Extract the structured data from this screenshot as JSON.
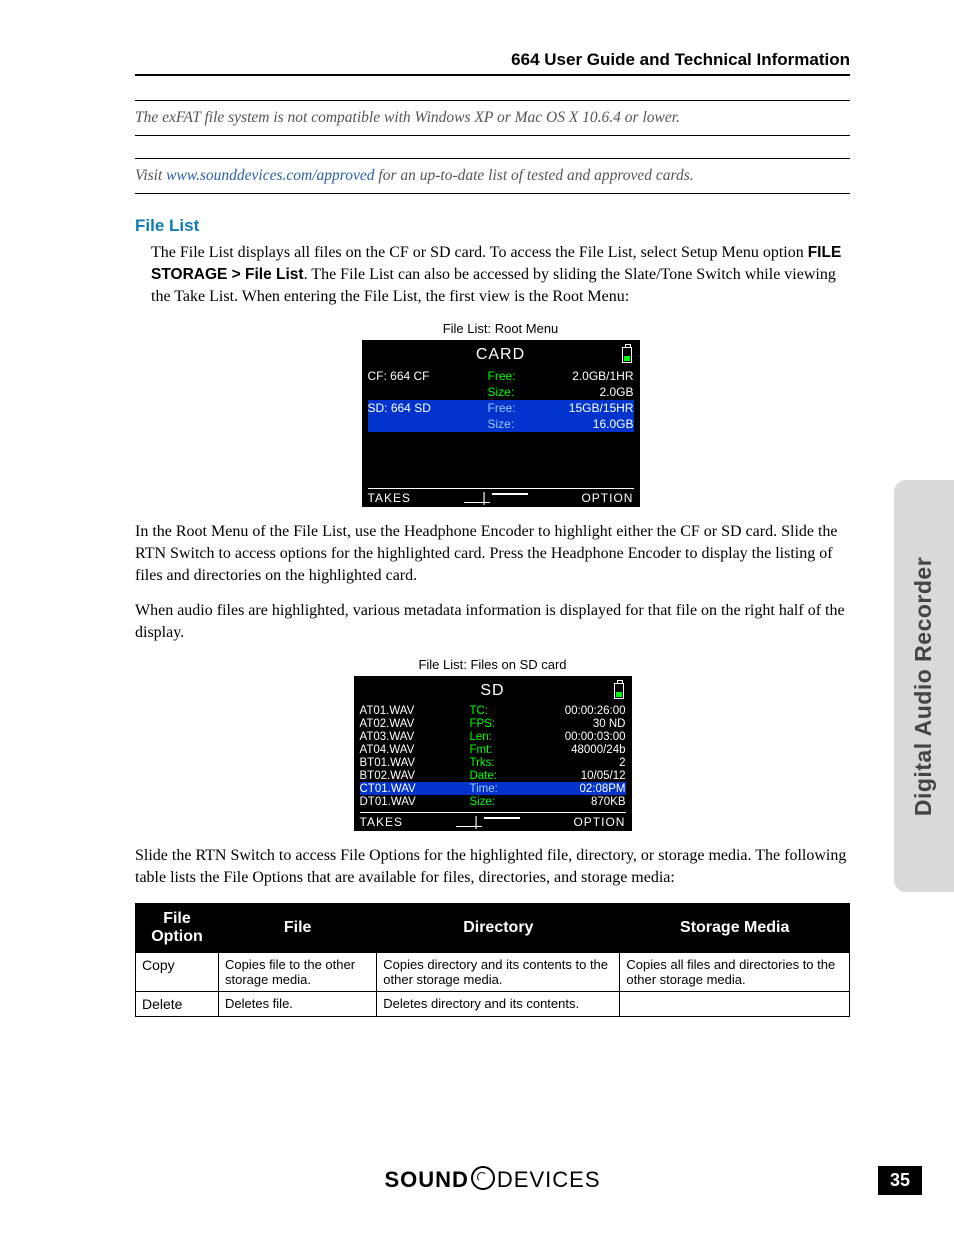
{
  "header": {
    "title": "664 User Guide and Technical Information"
  },
  "callouts": {
    "exfat": "The exFAT file system is not compatible with Windows XP or Mac OS X 10.6.4 or lower.",
    "visit_pre": "Visit ",
    "visit_link": "www.sounddevices.com/approved",
    "visit_post": " for an up-to-date list of tested and approved cards."
  },
  "section": {
    "title": "File List"
  },
  "paragraphs": {
    "p1a": "The File List displays all files on the CF or SD card. To access the File List, select Setup Menu option ",
    "p1_menu": "FILE STORAGE > File List",
    "p1b": ". The File List can also be accessed by sliding the Slate/Tone Switch while viewing the Take List. When entering the File List, the first view is the Root Menu:",
    "p2": "In the Root Menu of the File List, use the Headphone Encoder to highlight either the CF or SD card. Slide the RTN Switch to access options for the highlighted card. Press the Headphone Encoder to display the listing of files and directories  on the highlighted card.",
    "p3": "When audio files are highlighted, various metadata information is displayed for that file on the right half of the display.",
    "p4": "Slide the RTN Switch to access File Options for the highlighted file, directory, or storage media. The following table lists the File Options that are available for files, directories, and storage media:"
  },
  "fig1": {
    "caption": "File List: Root Menu",
    "title": "CARD",
    "rows": [
      {
        "left": "CF: 664 CF",
        "r1": "Free:",
        "v1": "2.0GB/1HR",
        "r2": "Size:",
        "v2": "2.0GB",
        "sel": false
      },
      {
        "left": "SD: 664 SD",
        "r1": "Free:",
        "v1": "15GB/15HR",
        "r2": "Size:",
        "v2": "16.0GB",
        "sel": true
      }
    ],
    "footer": {
      "left": "TAKES",
      "right": "OPTION"
    }
  },
  "fig2": {
    "caption": "File List: Files on SD card",
    "title": "SD",
    "files": [
      "AT01.WAV",
      "AT02.WAV",
      "AT03.WAV",
      "AT04.WAV",
      "BT01.WAV",
      "BT02.WAV",
      "CT01.WAV",
      "DT01.WAV"
    ],
    "selected_index": 6,
    "meta": [
      {
        "k": "TC:",
        "v": "00:00:26:00"
      },
      {
        "k": "FPS:",
        "v": "30 ND"
      },
      {
        "k": "Len:",
        "v": "00:00:03:00"
      },
      {
        "k": "Fmt:",
        "v": "48000/24b"
      },
      {
        "k": "Trks:",
        "v": "2"
      },
      {
        "k": "Date:",
        "v": "10/05/12"
      },
      {
        "k": "Time:",
        "v": "02:08PM"
      },
      {
        "k": "Size:",
        "v": "870KB"
      }
    ],
    "footer": {
      "left": "TAKES",
      "right": "OPTION"
    }
  },
  "table": {
    "headers": [
      "File Option",
      "File",
      "Directory",
      "Storage Media"
    ],
    "rows": [
      [
        "Copy",
        "Copies file to the other storage media.",
        "Copies directory and its contents to the other storage media.",
        "Copies all files and directories to the other storage media."
      ],
      [
        "Delete",
        "Deletes file.",
        "Deletes directory and its contents.",
        ""
      ]
    ]
  },
  "sidebar": {
    "label": "Digital Audio Recorder"
  },
  "footer": {
    "brand1": "SOUND",
    "brand2": "DEVICES",
    "page": "35"
  }
}
